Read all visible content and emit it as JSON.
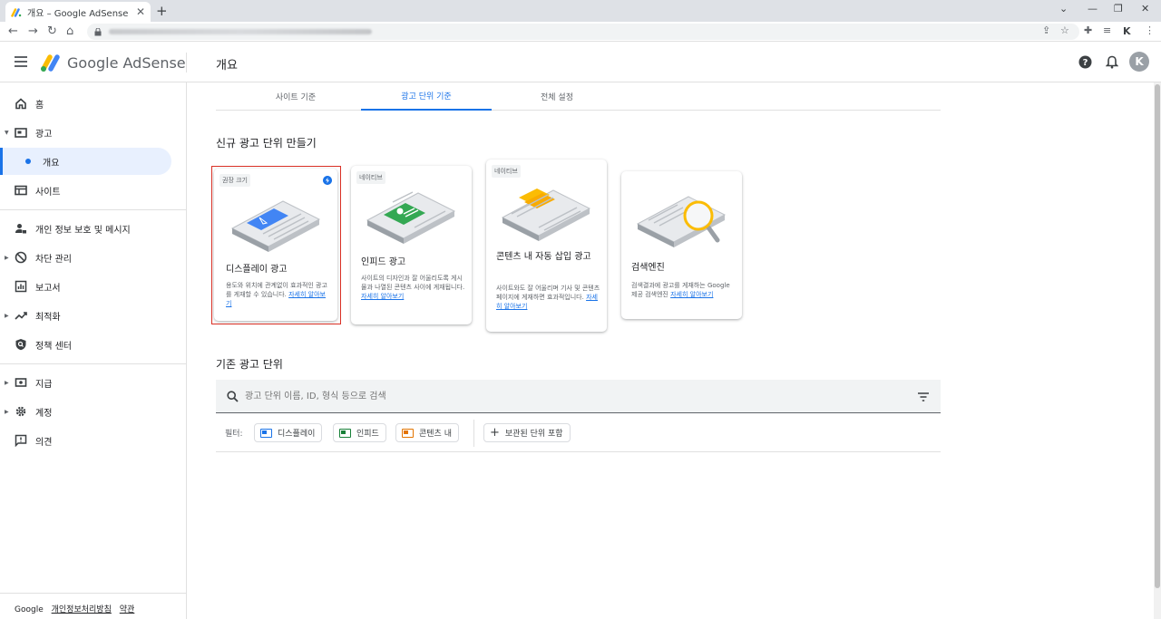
{
  "browser": {
    "tab_title": "개요 – Google AdSense",
    "tab_close": "✕",
    "new_tab": "+"
  },
  "header": {
    "brand": "Google AdSense",
    "page_title": "개요",
    "avatar_letter": "K"
  },
  "sidebar": {
    "items": [
      {
        "label": "홈",
        "icon": "home-icon"
      },
      {
        "label": "광고",
        "icon": "ads-icon"
      },
      {
        "label": "개요",
        "icon": "dot"
      },
      {
        "label": "사이트",
        "icon": "sites-icon"
      },
      {
        "label": "개인 정보 보호 및 메시지",
        "icon": "privacy-icon"
      },
      {
        "label": "차단 관리",
        "icon": "block-icon"
      },
      {
        "label": "보고서",
        "icon": "reports-icon"
      },
      {
        "label": "최적화",
        "icon": "optimize-icon"
      },
      {
        "label": "정책 센터",
        "icon": "policy-icon"
      },
      {
        "label": "지급",
        "icon": "payments-icon"
      },
      {
        "label": "계정",
        "icon": "gear-icon"
      },
      {
        "label": "의견",
        "icon": "feedback-icon"
      }
    ],
    "footer": {
      "google": "Google",
      "privacy": "개인정보처리방침",
      "terms": "약관"
    }
  },
  "tabs": [
    "사이트 기준",
    "광고 단위 기준",
    "전체 설정"
  ],
  "new_ad_unit": {
    "title": "신규 광고 단위 만들기",
    "cards": [
      {
        "tag": "권장 크기",
        "title": "디스플레이 광고",
        "desc": "용도와 위치에 관계없이 효과적인 광고를 게재할 수 있습니다.",
        "link": "자세히 알아보기"
      },
      {
        "tag": "네이티브",
        "title": "인피드 광고",
        "desc": "사이트의 디자인과 잘 어울리도록 게시물과 나열된 콘텐츠 사이에 게재됩니다.",
        "link": "자세히 알아보기"
      },
      {
        "tag": "네이티브",
        "title": "콘텐츠 내 자동 삽입 광고",
        "desc": "사이트와도 잘 어울리며 기사 및 콘텐츠 페이지에 게재하면 효과적입니다.",
        "link": "자세히 알아보기"
      },
      {
        "tag": "",
        "title": "검색엔진",
        "desc": "검색결과에 광고를 게재하는 Google 제공 검색엔진",
        "link": "자세히 알아보기"
      }
    ]
  },
  "existing": {
    "title": "기존 광고 단위",
    "search_placeholder": "광고 단위 이름, ID, 형식 등으로 검색",
    "filter_label": "필터:",
    "chips": [
      {
        "label": "디스플레이",
        "color": "#1a73e8"
      },
      {
        "label": "인피드",
        "color": "#188038"
      },
      {
        "label": "콘텐츠 내",
        "color": "#e37400"
      }
    ],
    "archived_chip": "보관된 단위 포함"
  },
  "colors": {
    "accent": "#1a73e8",
    "highlight": "#d93025"
  }
}
